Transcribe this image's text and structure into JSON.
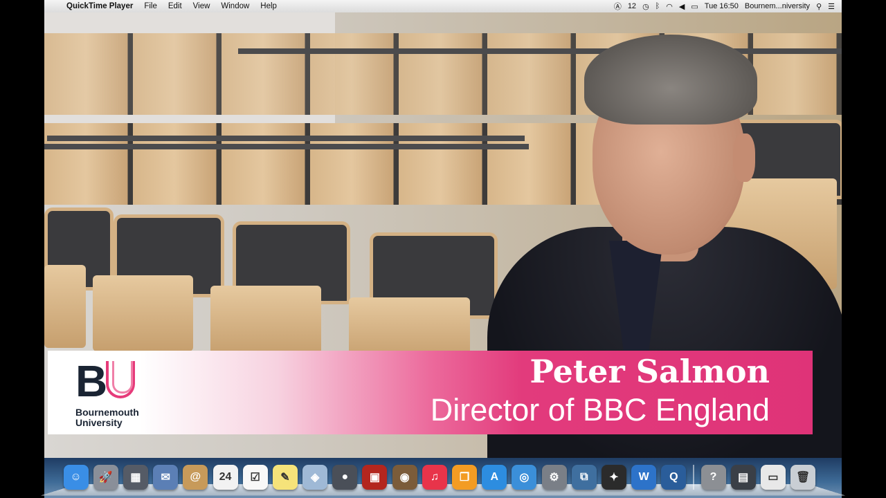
{
  "menubar": {
    "apple": "",
    "app_name": "QuickTime Player",
    "menus": [
      "File",
      "Edit",
      "View",
      "Window",
      "Help"
    ],
    "status": {
      "adobe_badge": "12",
      "clock": "Tue 16:50",
      "user": "Bournem...niversity"
    }
  },
  "lower_third": {
    "logo_letters": "BU",
    "logo_name_line1": "Bournemouth",
    "logo_name_line2": "University",
    "person_name": "Peter Salmon",
    "person_title": "Director of BBC England"
  },
  "dock": {
    "items": [
      {
        "name": "finder-icon",
        "color": "#3a8ee6",
        "glyph": "☺"
      },
      {
        "name": "launchpad-icon",
        "color": "#8a8f99",
        "glyph": "🚀"
      },
      {
        "name": "mission-control-icon",
        "color": "#555b66",
        "glyph": "▦"
      },
      {
        "name": "mail-stamp-icon",
        "color": "#5b7fb5",
        "glyph": "✉"
      },
      {
        "name": "contacts-icon",
        "color": "#c79a5a",
        "glyph": "@"
      },
      {
        "name": "calendar-icon",
        "color": "#f2f2f2",
        "glyph": "24"
      },
      {
        "name": "reminders-icon",
        "color": "#f8f8f8",
        "glyph": "☑"
      },
      {
        "name": "notes-icon",
        "color": "#f5e37a",
        "glyph": "✎"
      },
      {
        "name": "preview-icon",
        "color": "#9fb9d6",
        "glyph": "◈"
      },
      {
        "name": "facetime-icon",
        "color": "#4a4f58",
        "glyph": "●"
      },
      {
        "name": "photo-booth-icon",
        "color": "#b3261e",
        "glyph": "▣"
      },
      {
        "name": "iphoto-icon",
        "color": "#7b5c3a",
        "glyph": "◉"
      },
      {
        "name": "itunes-icon",
        "color": "#e8344a",
        "glyph": "♫"
      },
      {
        "name": "ibooks-icon",
        "color": "#f39c23",
        "glyph": "❐"
      },
      {
        "name": "app-store-icon",
        "color": "#2d8de0",
        "glyph": "A"
      },
      {
        "name": "safari-icon",
        "color": "#3b8fd9",
        "glyph": "◎"
      },
      {
        "name": "system-preferences-icon",
        "color": "#7a7f87",
        "glyph": "⚙"
      },
      {
        "name": "screen-sharing-icon",
        "color": "#3f6f9f",
        "glyph": "⧉"
      },
      {
        "name": "final-cut-icon",
        "color": "#2b2b2b",
        "glyph": "✦"
      },
      {
        "name": "word-icon",
        "color": "#2d73c9",
        "glyph": "W"
      },
      {
        "name": "quicktime-icon",
        "color": "#2a5d9a",
        "glyph": "Q"
      },
      {
        "name": "help-icon",
        "color": "#8c8f94",
        "glyph": "?"
      },
      {
        "name": "downloads-stack-icon",
        "color": "#3a3f47",
        "glyph": "▤"
      },
      {
        "name": "document-stack-icon",
        "color": "#e8e8e8",
        "glyph": "▭"
      },
      {
        "name": "trash-icon",
        "color": "#c9ced4",
        "glyph": "🗑"
      }
    ]
  }
}
